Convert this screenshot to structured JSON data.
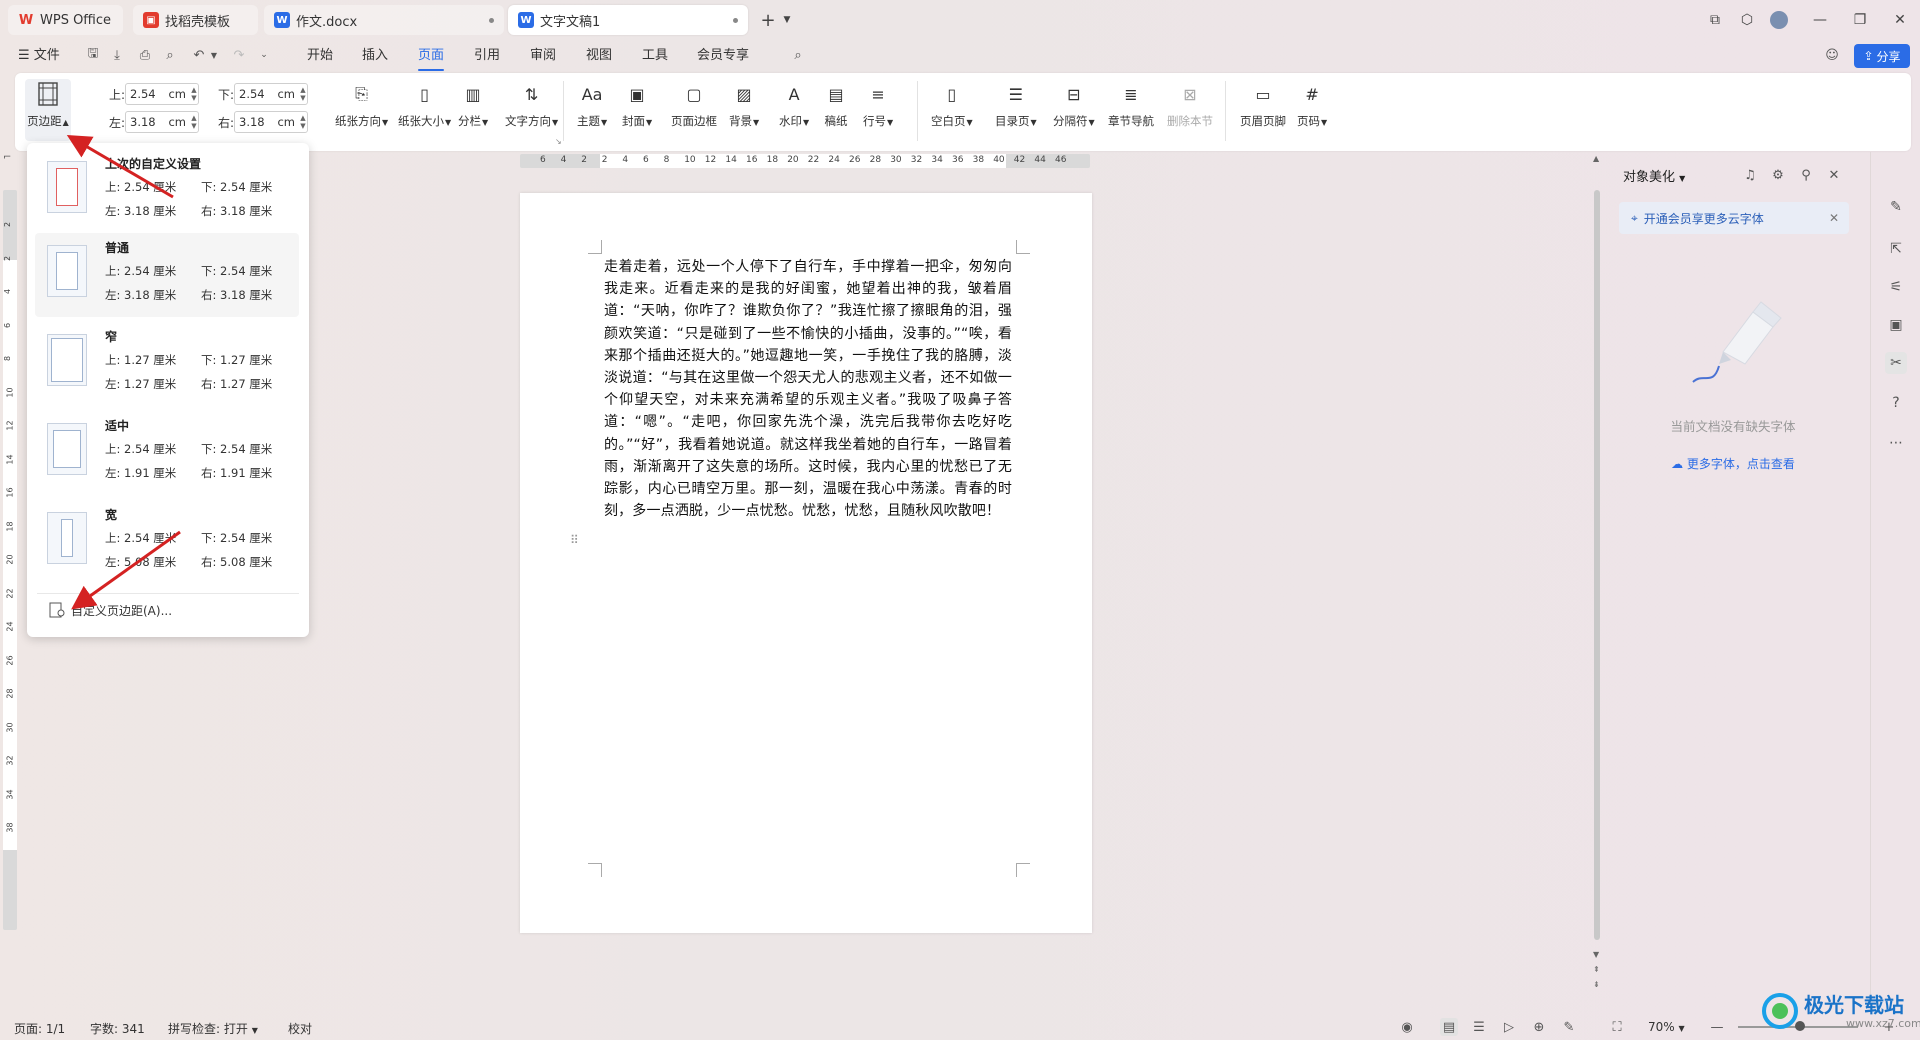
{
  "tabs": [
    {
      "label": "WPS Office",
      "icon": "wps-logo-icon",
      "color": "#e23b2e"
    },
    {
      "label": "找稻壳模板",
      "icon": "docer-icon",
      "color": "#e23b2e"
    },
    {
      "label": "作文.docx",
      "icon": "word-doc-icon",
      "color": "#2b6ce6"
    },
    {
      "label": "文字文稿1",
      "icon": "word-doc-icon",
      "color": "#2b6ce6"
    }
  ],
  "menubar": {
    "file_label": "文件",
    "items": [
      "开始",
      "插入",
      "页面",
      "引用",
      "审阅",
      "视图",
      "工具",
      "会员专享"
    ],
    "active": "页面",
    "share_label": "分享"
  },
  "ribbon": {
    "margin_button": "页边距",
    "margins": {
      "top_label": "上:",
      "top_value": "2.54",
      "bottom_label": "下:",
      "bottom_value": "2.54",
      "left_label": "左:",
      "left_value": "3.18",
      "right_label": "右:",
      "right_value": "3.18",
      "unit": "cm"
    },
    "buttons": [
      {
        "label": "纸张方向",
        "dropdown": true
      },
      {
        "label": "纸张大小",
        "dropdown": true
      },
      {
        "label": "分栏",
        "dropdown": true
      },
      {
        "label": "文字方向",
        "dropdown": true
      },
      {
        "label": "主题",
        "dropdown": true
      },
      {
        "label": "封面",
        "dropdown": true
      },
      {
        "label": "页面边框",
        "dropdown": false
      },
      {
        "label": "背景",
        "dropdown": true
      },
      {
        "label": "水印",
        "dropdown": true
      },
      {
        "label": "稿纸",
        "dropdown": false
      },
      {
        "label": "行号",
        "dropdown": true
      },
      {
        "label": "空白页",
        "dropdown": true
      },
      {
        "label": "目录页",
        "dropdown": true
      },
      {
        "label": "分隔符",
        "dropdown": true
      },
      {
        "label": "章节导航",
        "dropdown": false
      },
      {
        "label": "删除本节",
        "dropdown": false,
        "disabled": true
      },
      {
        "label": "页眉页脚",
        "dropdown": false
      },
      {
        "label": "页码",
        "dropdown": true
      }
    ]
  },
  "margin_dropdown": {
    "presets": [
      {
        "name": "上次的自定义设置",
        "top": "上: 2.54 厘米",
        "bottom": "下: 2.54 厘米",
        "left": "左: 3.18 厘米",
        "right": "右: 3.18 厘米"
      },
      {
        "name": "普通",
        "top": "上: 2.54 厘米",
        "bottom": "下: 2.54 厘米",
        "left": "左: 3.18 厘米",
        "right": "右: 3.18 厘米"
      },
      {
        "name": "窄",
        "top": "上: 1.27 厘米",
        "bottom": "下: 1.27 厘米",
        "left": "左: 1.27 厘米",
        "right": "右: 1.27 厘米"
      },
      {
        "name": "适中",
        "top": "上: 2.54 厘米",
        "bottom": "下: 2.54 厘米",
        "left": "左: 1.91 厘米",
        "right": "右: 1.91 厘米"
      },
      {
        "name": "宽",
        "top": "上: 2.54 厘米",
        "bottom": "下: 2.54 厘米",
        "left": "左: 5.08 厘米",
        "right": "右: 5.08 厘米"
      }
    ],
    "custom_label": "自定义页边距(A)..."
  },
  "hruler_ticks": [
    "6",
    "4",
    "2",
    "2",
    "4",
    "6",
    "8",
    "10",
    "12",
    "14",
    "16",
    "18",
    "20",
    "22",
    "24",
    "26",
    "28",
    "30",
    "32",
    "34",
    "36",
    "38",
    "40",
    "42",
    "44",
    "46"
  ],
  "vruler_ticks": [
    "2",
    "2",
    "4",
    "6",
    "8",
    "10",
    "12",
    "14",
    "16",
    "18",
    "20",
    "22",
    "24",
    "26",
    "28",
    "30",
    "32",
    "34",
    "38"
  ],
  "document": {
    "text": "走着走着，远处一个人停下了自行车，手中撑着一把伞，匆匆向我走来。近看走来的是我的好闺蜜，她望着出神的我，皱着眉道：“天呐，你咋了？谁欺负你了？”我连忙擦了擦眼角的泪，强颜欢笑道：“只是碰到了一些不愉快的小插曲，没事的。”“唉，看来那个插曲还挺大的。”她逗趣地一笑，一手挽住了我的胳膊，淡淡说道：“与其在这里做一个怨天尤人的悲观主义者，还不如做一个仰望天空，对未来充满希望的乐观主义者。”我吸了吸鼻子答道：“嗯”。“走吧，你回家先洗个澡，洗完后我带你去吃好吃的。”“好”，我看着她说道。就这样我坐着她的自行车，一路冒着雨，渐渐离开了这失意的场所。这时候，我内心里的忧愁已了无踪影，内心已晴空万里。那一刻，温暖在我心中荡漾。青春的时刻，多一点洒脱，少一点忧愁。忧愁，忧愁，且随秋风吹散吧！"
  },
  "right_panel": {
    "title": "对象美化",
    "banner": "开通会员享更多云字体",
    "empty_text": "当前文档没有缺失字体",
    "more_link": "更多字体，点击查看"
  },
  "status": {
    "page": "页面: 1/1",
    "words": "字数: 341",
    "spell": "拼写检查: 打开",
    "proof": "校对",
    "zoom": "70%"
  },
  "watermark_text": "极光下载站",
  "watermark_sub": "www.xz7.com",
  "colors": {
    "accent": "#2b6ce6",
    "wps_red": "#e23b2e",
    "annotation_arrow": "#d42222"
  }
}
